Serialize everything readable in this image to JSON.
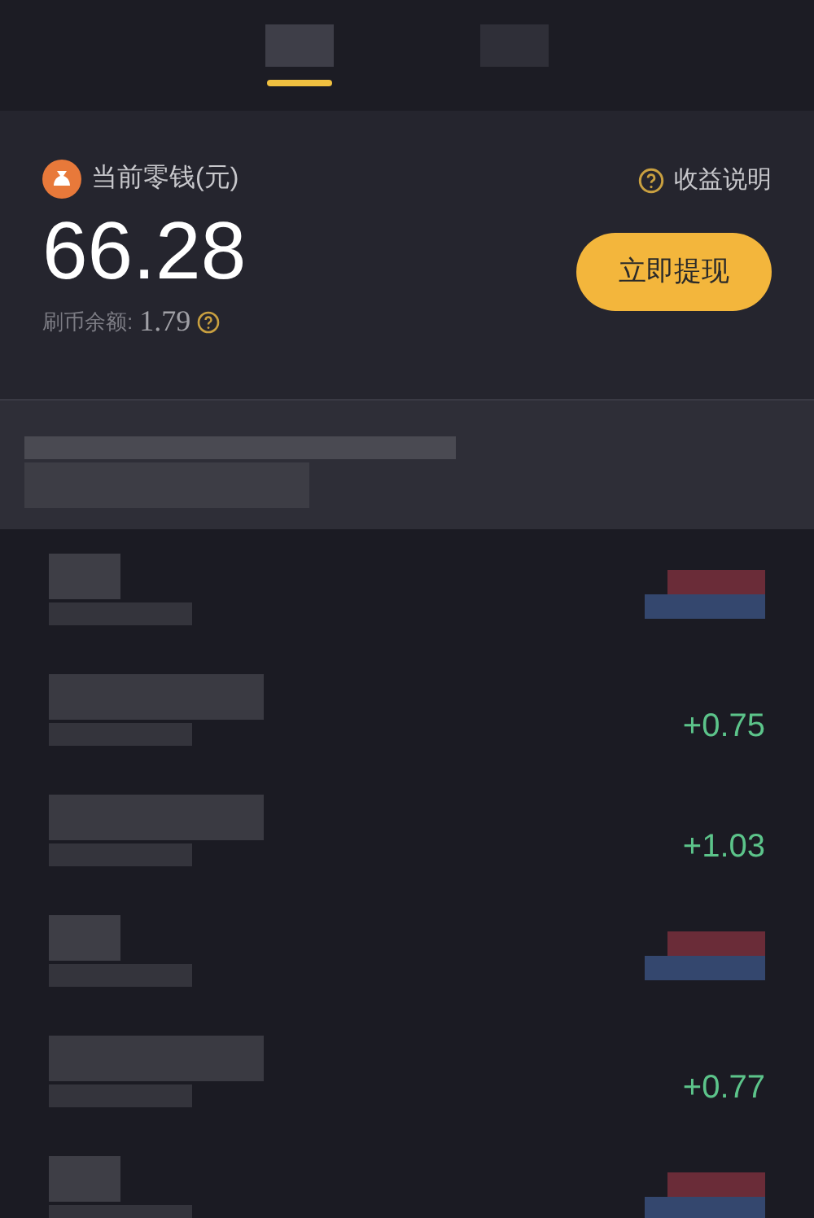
{
  "tabs": [
    {
      "selected": true
    },
    {
      "selected": false
    }
  ],
  "balance": {
    "label": "当前零钱(元)",
    "help": "收益说明",
    "amount": "66.28",
    "coin_label": "刷币余额:",
    "coin_amount": "1.79",
    "button": "立即提现"
  },
  "records": [
    {
      "kind": "redacted"
    },
    {
      "kind": "amount",
      "amount": "+0.75"
    },
    {
      "kind": "amount",
      "amount": "+1.03"
    },
    {
      "kind": "redacted"
    },
    {
      "kind": "amount",
      "amount": "+0.77"
    },
    {
      "kind": "redacted"
    }
  ]
}
